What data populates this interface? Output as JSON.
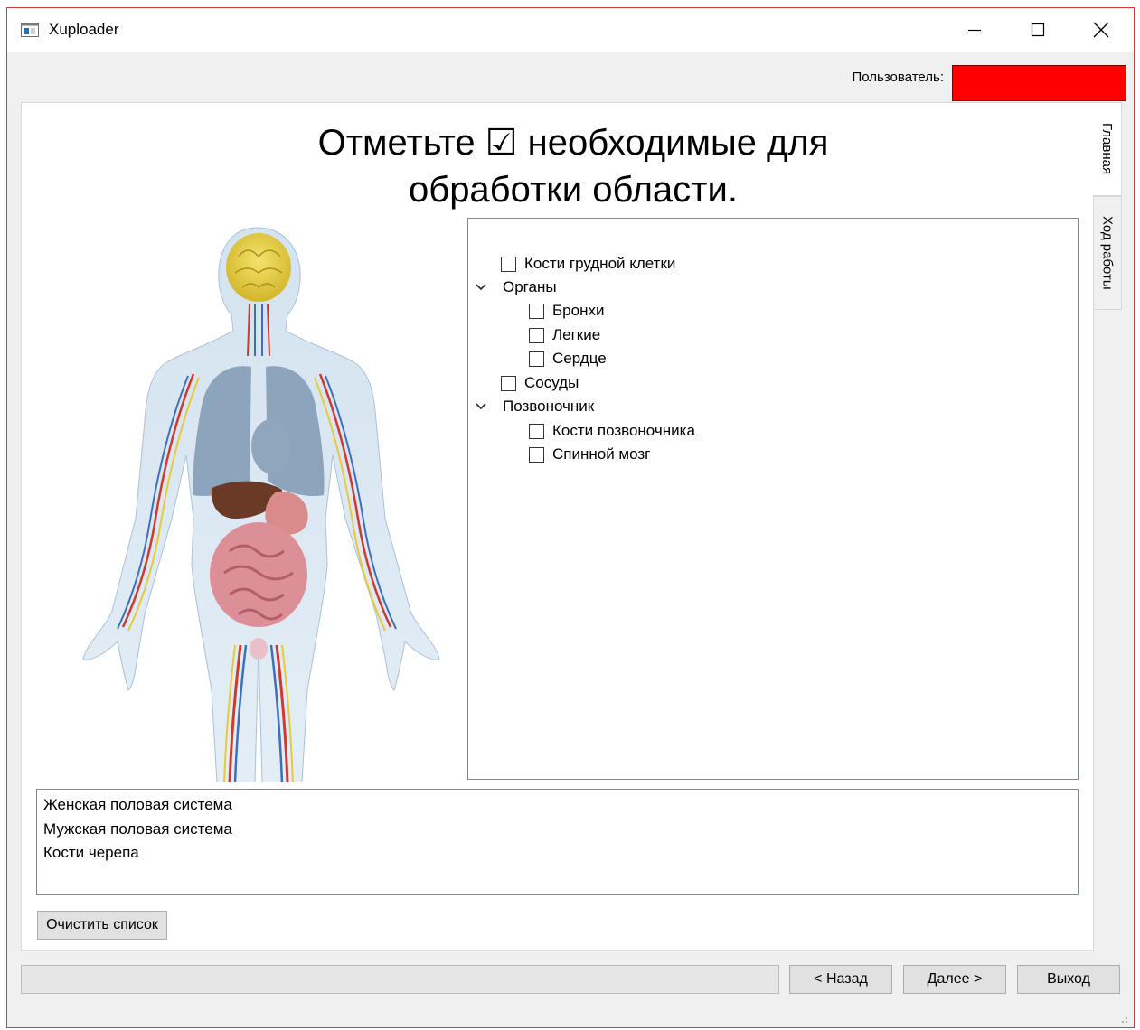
{
  "window": {
    "title": "Xuploader"
  },
  "header": {
    "user_label": "Пользователь:",
    "user_value": "",
    "user_field_color": "#ff0000"
  },
  "main": {
    "heading_line1": "Отметьте ☑ необходимые для",
    "heading_line2": "обработки области.",
    "tabs": [
      {
        "label": "Главная"
      },
      {
        "label": "Ход работы"
      }
    ],
    "tree": [
      {
        "label": "Кости грудной клетки",
        "type": "checkbox",
        "level": 1,
        "checked": false
      },
      {
        "label": "Органы",
        "type": "group",
        "level": 0,
        "expanded": true
      },
      {
        "label": "Бронхи",
        "type": "checkbox",
        "level": 2,
        "checked": false
      },
      {
        "label": "Легкие",
        "type": "checkbox",
        "level": 2,
        "checked": false
      },
      {
        "label": "Сердце",
        "type": "checkbox",
        "level": 2,
        "checked": false
      },
      {
        "label": "Сосуды",
        "type": "checkbox",
        "level": 1,
        "checked": false
      },
      {
        "label": "Позвоночник",
        "type": "group",
        "level": 0,
        "expanded": true
      },
      {
        "label": "Кости позвоночника",
        "type": "checkbox",
        "level": 2,
        "checked": false
      },
      {
        "label": "Спинной мозг",
        "type": "checkbox",
        "level": 2,
        "checked": false
      }
    ],
    "selected_items": [
      "Женская половая система",
      "Мужская половая система",
      "Кости черепа"
    ],
    "clear_button": "Очистить список"
  },
  "footer": {
    "back_button": "< Назад",
    "next_button": "Далее >",
    "exit_button": "Выход",
    "progress": 0
  }
}
